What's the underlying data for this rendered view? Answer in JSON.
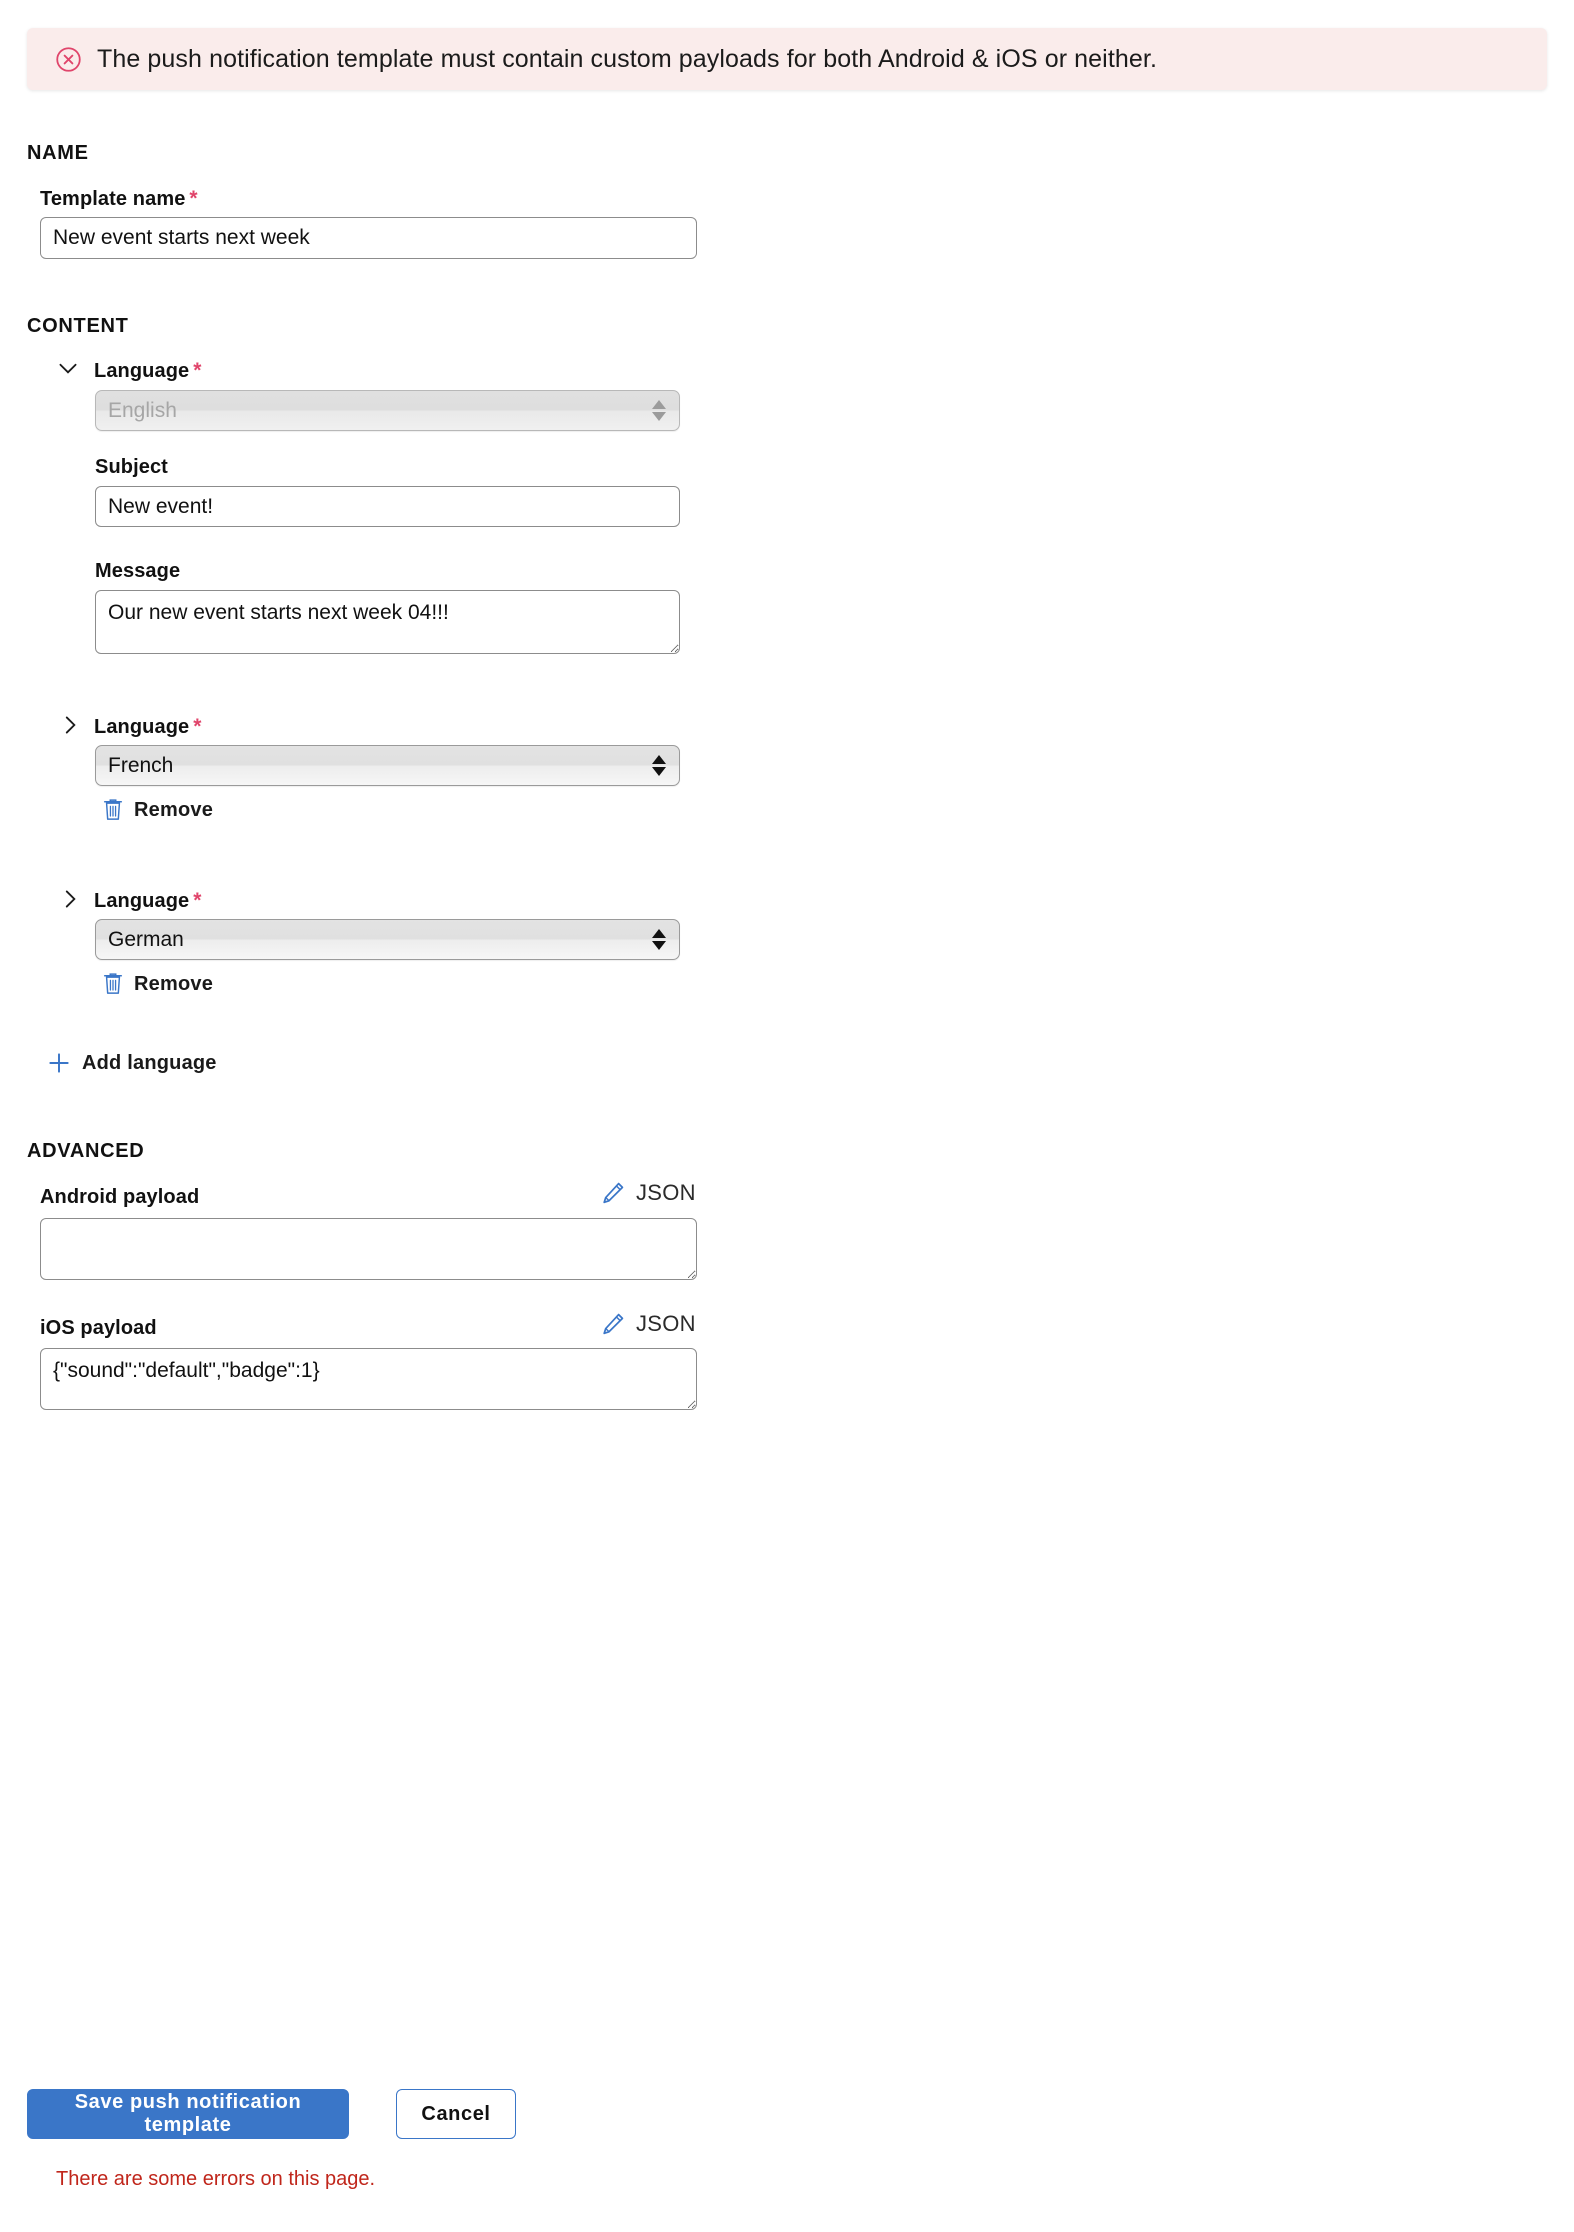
{
  "alert": {
    "icon": "error-circle-x-icon",
    "message": "The push notification template must contain custom payloads for both Android & iOS or neither.",
    "background_color": "#faeceb",
    "icon_color": "#e0456b"
  },
  "sections": {
    "name": "NAME",
    "content": "CONTENT",
    "advanced": "ADVANCED"
  },
  "name_section": {
    "template_name_label": "Template name",
    "template_name_value": "New event starts next week",
    "template_name_placeholder": "",
    "required_marker": "*"
  },
  "content_section": {
    "language_label": "Language",
    "required_marker": "*",
    "subject_label": "Subject",
    "message_label": "Message",
    "remove_label": "Remove",
    "add_language_label": "Add language",
    "languages": [
      {
        "expanded": true,
        "chevron": "chevron-down-icon",
        "value": "English",
        "disabled": true,
        "subject": "New event!",
        "subject_placeholder": "",
        "message": "Our new event starts next week 04!!!",
        "message_placeholder": "",
        "removable": false
      },
      {
        "expanded": false,
        "chevron": "chevron-right-icon",
        "value": "French",
        "disabled": false,
        "removable": true
      },
      {
        "expanded": false,
        "chevron": "chevron-right-icon",
        "value": "German",
        "disabled": false,
        "removable": true
      }
    ]
  },
  "advanced_section": {
    "android_payload_label": "Android payload",
    "android_payload_value": "",
    "android_payload_placeholder": "",
    "ios_payload_label": "iOS payload",
    "ios_payload_value": "{\"sound\":\"default\",\"badge\":1}",
    "ios_payload_placeholder": "",
    "json_link_label": "JSON",
    "json_icon": "pencil-icon"
  },
  "footer": {
    "save_label": "Save push notification template",
    "cancel_label": "Cancel",
    "error_text": "There are some errors on this page.",
    "primary_color": "#3a76c8",
    "error_color": "#c0261b"
  }
}
